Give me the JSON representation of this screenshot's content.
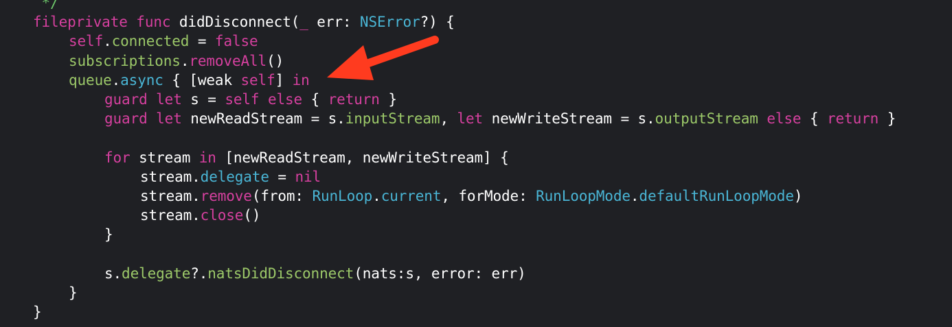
{
  "editor": {
    "lines": [
      {
        "indent": 0,
        "tokens": [
          {
            "t": " */",
            "k": "c-comment"
          }
        ]
      },
      {
        "indent": 0,
        "tokens": [
          {
            "t": "fileprivate",
            "k": "c-kw"
          },
          {
            "t": " ",
            "k": "tok-plain"
          },
          {
            "t": "func",
            "k": "c-kw"
          },
          {
            "t": " didDisconnect(",
            "k": "tok-plain"
          },
          {
            "t": "_",
            "k": "c-kw"
          },
          {
            "t": " err: ",
            "k": "tok-plain"
          },
          {
            "t": "NSError",
            "k": "c-api"
          },
          {
            "t": "?) {",
            "k": "tok-plain"
          }
        ]
      },
      {
        "indent": 1,
        "tokens": [
          {
            "t": "self",
            "k": "c-kw"
          },
          {
            "t": ".",
            "k": "tok-plain"
          },
          {
            "t": "connected",
            "k": "c-local"
          },
          {
            "t": " = ",
            "k": "tok-plain"
          },
          {
            "t": "false",
            "k": "c-kw"
          }
        ]
      },
      {
        "indent": 1,
        "tokens": [
          {
            "t": "subscriptions",
            "k": "c-local"
          },
          {
            "t": ".",
            "k": "tok-plain"
          },
          {
            "t": "removeAll",
            "k": "c-kw"
          },
          {
            "t": "()",
            "k": "tok-plain"
          }
        ]
      },
      {
        "indent": 1,
        "tokens": [
          {
            "t": "queue",
            "k": "c-local"
          },
          {
            "t": ".",
            "k": "tok-plain"
          },
          {
            "t": "async",
            "k": "c-api"
          },
          {
            "t": " { [weak ",
            "k": "tok-plain"
          },
          {
            "t": "self",
            "k": "c-kw"
          },
          {
            "t": "] ",
            "k": "tok-plain"
          },
          {
            "t": "in",
            "k": "c-kw"
          }
        ]
      },
      {
        "indent": 2,
        "tokens": [
          {
            "t": "guard",
            "k": "c-kw"
          },
          {
            "t": " ",
            "k": "tok-plain"
          },
          {
            "t": "let",
            "k": "c-kw"
          },
          {
            "t": " s = ",
            "k": "tok-plain"
          },
          {
            "t": "self",
            "k": "c-kw"
          },
          {
            "t": " ",
            "k": "tok-plain"
          },
          {
            "t": "else",
            "k": "c-kw"
          },
          {
            "t": " { ",
            "k": "tok-plain"
          },
          {
            "t": "return",
            "k": "c-kw"
          },
          {
            "t": " }",
            "k": "tok-plain"
          }
        ]
      },
      {
        "indent": 2,
        "tokens": [
          {
            "t": "guard",
            "k": "c-kw"
          },
          {
            "t": " ",
            "k": "tok-plain"
          },
          {
            "t": "let",
            "k": "c-kw"
          },
          {
            "t": " newReadStream = s.",
            "k": "tok-plain"
          },
          {
            "t": "inputStream",
            "k": "c-local"
          },
          {
            "t": ", ",
            "k": "tok-plain"
          },
          {
            "t": "let",
            "k": "c-kw"
          },
          {
            "t": " newWriteStream = s.",
            "k": "tok-plain"
          },
          {
            "t": "outputStream",
            "k": "c-local"
          },
          {
            "t": " ",
            "k": "tok-plain"
          },
          {
            "t": "else",
            "k": "c-kw"
          },
          {
            "t": " { ",
            "k": "tok-plain"
          },
          {
            "t": "return",
            "k": "c-kw"
          },
          {
            "t": " }",
            "k": "tok-plain"
          }
        ]
      },
      {
        "indent": 0,
        "tokens": []
      },
      {
        "indent": 2,
        "tokens": [
          {
            "t": "for",
            "k": "c-kw"
          },
          {
            "t": " stream ",
            "k": "tok-plain"
          },
          {
            "t": "in",
            "k": "c-kw"
          },
          {
            "t": " [newReadStream, newWriteStream] {",
            "k": "tok-plain"
          }
        ]
      },
      {
        "indent": 3,
        "tokens": [
          {
            "t": "stream.",
            "k": "tok-plain"
          },
          {
            "t": "delegate",
            "k": "c-api"
          },
          {
            "t": " = ",
            "k": "tok-plain"
          },
          {
            "t": "nil",
            "k": "c-kw"
          }
        ]
      },
      {
        "indent": 3,
        "tokens": [
          {
            "t": "stream.",
            "k": "tok-plain"
          },
          {
            "t": "remove",
            "k": "c-kw"
          },
          {
            "t": "(from: ",
            "k": "tok-plain"
          },
          {
            "t": "RunLoop",
            "k": "c-api"
          },
          {
            "t": ".",
            "k": "tok-plain"
          },
          {
            "t": "current",
            "k": "c-api"
          },
          {
            "t": ", forMode: ",
            "k": "tok-plain"
          },
          {
            "t": "RunLoopMode",
            "k": "c-api"
          },
          {
            "t": ".",
            "k": "tok-plain"
          },
          {
            "t": "defaultRunLoopMode",
            "k": "c-api"
          },
          {
            "t": ")",
            "k": "tok-plain"
          }
        ]
      },
      {
        "indent": 3,
        "tokens": [
          {
            "t": "stream.",
            "k": "tok-plain"
          },
          {
            "t": "close",
            "k": "c-kw"
          },
          {
            "t": "()",
            "k": "tok-plain"
          }
        ]
      },
      {
        "indent": 2,
        "tokens": [
          {
            "t": "}",
            "k": "tok-plain"
          }
        ]
      },
      {
        "indent": 0,
        "tokens": []
      },
      {
        "indent": 2,
        "tokens": [
          {
            "t": "s.",
            "k": "tok-plain"
          },
          {
            "t": "delegate",
            "k": "c-local"
          },
          {
            "t": "?.",
            "k": "tok-plain"
          },
          {
            "t": "natsDidDisconnect",
            "k": "c-local"
          },
          {
            "t": "(nats:s, error: err)",
            "k": "tok-plain"
          }
        ]
      },
      {
        "indent": 1,
        "tokens": [
          {
            "t": "}",
            "k": "tok-plain"
          }
        ]
      },
      {
        "indent": 0,
        "tokens": [
          {
            "t": "}",
            "k": "tok-plain"
          }
        ]
      }
    ]
  },
  "colors": {
    "background": "#1f2024",
    "keyword": "#d6409f",
    "local": "#9cc969",
    "api": "#4ab6d6",
    "comment": "#6fc96b",
    "annotation_arrow": "#ff3b1f"
  },
  "annotation": {
    "icon": "arrow-annotation-icon"
  }
}
